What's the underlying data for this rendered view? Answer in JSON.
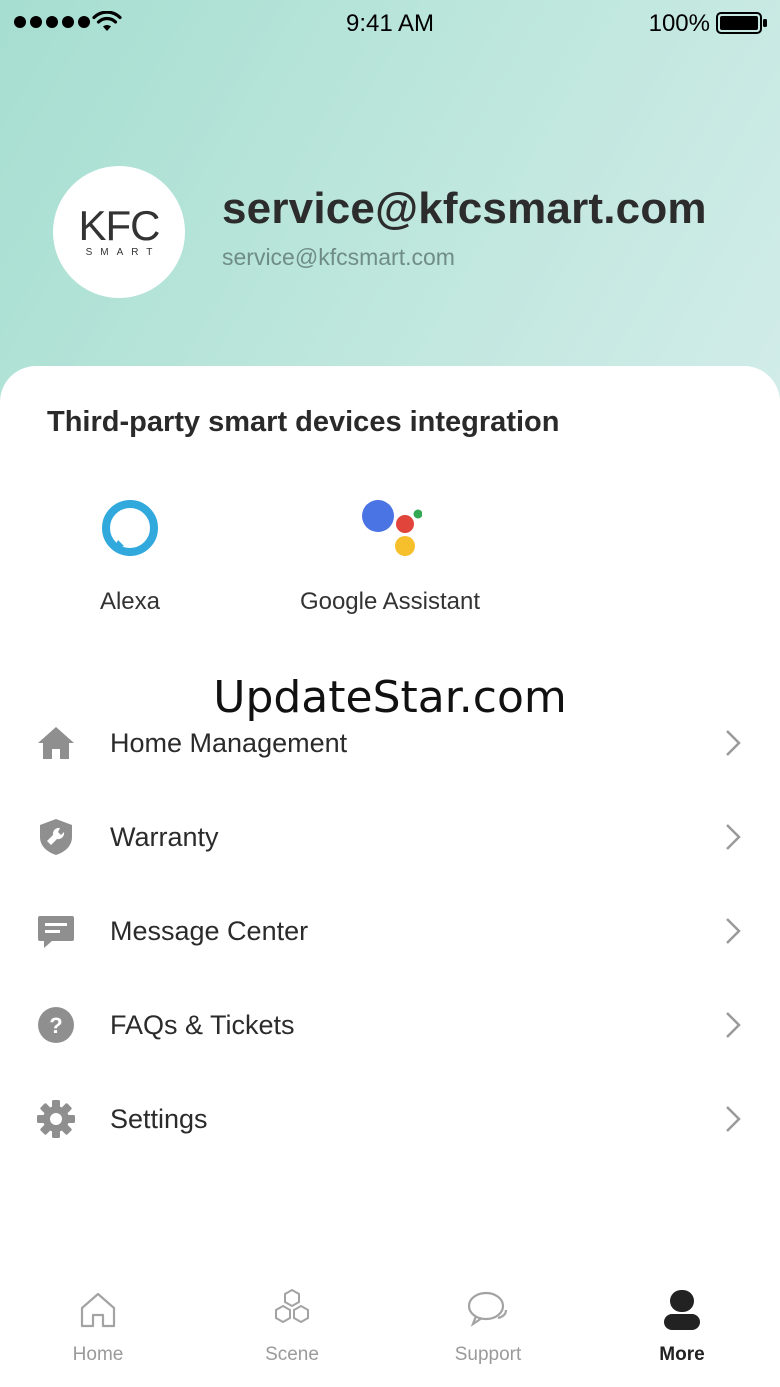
{
  "status_bar": {
    "time": "9:41 AM",
    "battery": "100%"
  },
  "profile": {
    "logo_text_main": "KFC",
    "logo_text_sub": "SMART",
    "name": "service@kfcsmart.com",
    "email": "service@kfcsmart.com"
  },
  "integration": {
    "title": "Third-party smart devices integration",
    "items": [
      {
        "label": "Alexa",
        "icon": "alexa-icon"
      },
      {
        "label": "Google Assistant",
        "icon": "google-assistant-icon"
      }
    ]
  },
  "watermark": "UpdateStar.com",
  "menu": [
    {
      "label": "Home Management",
      "icon": "home-icon"
    },
    {
      "label": "Warranty",
      "icon": "shield-wrench-icon"
    },
    {
      "label": "Message Center",
      "icon": "message-icon"
    },
    {
      "label": "FAQs & Tickets",
      "icon": "question-icon"
    },
    {
      "label": "Settings",
      "icon": "gear-icon"
    }
  ],
  "tabs": [
    {
      "label": "Home",
      "icon": "home-outline-icon",
      "active": false
    },
    {
      "label": "Scene",
      "icon": "hexagons-icon",
      "active": false
    },
    {
      "label": "Support",
      "icon": "chat-bubbles-icon",
      "active": false
    },
    {
      "label": "More",
      "icon": "person-icon",
      "active": true
    }
  ],
  "colors": {
    "header_gradient_start": "#a6ded1",
    "header_gradient_end": "#d2ecea",
    "icon_gray": "#8f8f8f",
    "tab_inactive": "#9a9a9a",
    "tab_active": "#222222",
    "alexa_blue": "#31a9dc"
  }
}
